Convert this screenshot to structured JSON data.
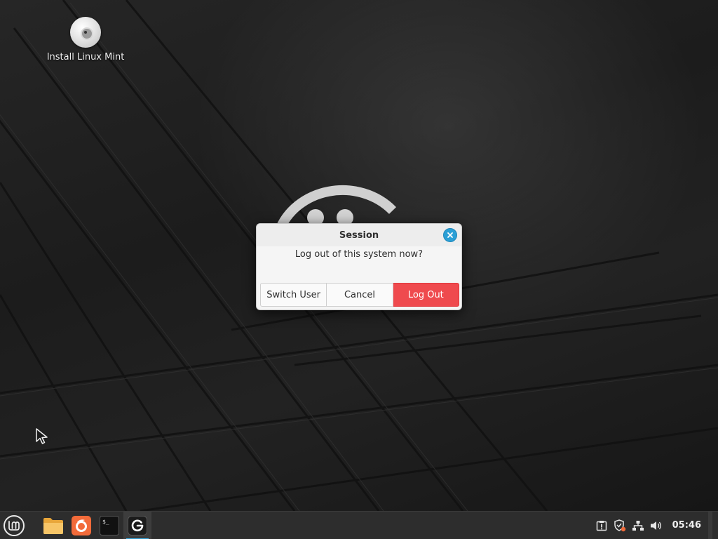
{
  "desktop": {
    "icons": [
      {
        "label": "Install Linux Mint",
        "icon": "disc-icon"
      }
    ]
  },
  "dialog": {
    "title": "Session",
    "message": "Log out of this system now?",
    "buttons": {
      "switch_user": "Switch User",
      "cancel": "Cancel",
      "log_out": "Log Out"
    },
    "close_icon": "close-icon"
  },
  "panel": {
    "menu_icon": "mint-logo-icon",
    "launchers": [
      {
        "name": "files",
        "icon": "folder-icon"
      },
      {
        "name": "firefox",
        "icon": "firefox-icon"
      },
      {
        "name": "terminal",
        "icon": "terminal-icon"
      },
      {
        "name": "session",
        "icon": "logout-icon",
        "active": true
      }
    ],
    "tray": [
      {
        "name": "update-manager",
        "icon": "update-icon"
      },
      {
        "name": "security",
        "icon": "shield-icon"
      },
      {
        "name": "network",
        "icon": "network-icon"
      },
      {
        "name": "volume",
        "icon": "speaker-icon"
      }
    ],
    "clock": "05:46"
  },
  "colors": {
    "accent": "#35a6de",
    "danger": "#ef4a4e",
    "panel": "#2d2d2d",
    "dialog_bg": "#f5f5f5"
  }
}
